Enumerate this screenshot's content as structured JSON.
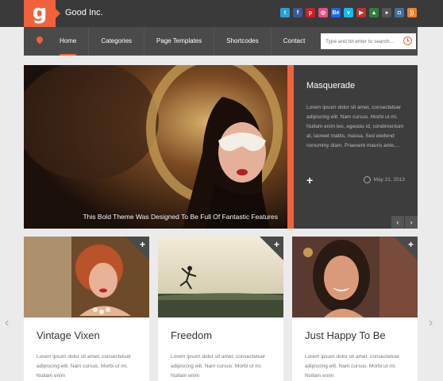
{
  "brand": {
    "logo_letter": "g",
    "name": "Good Inc."
  },
  "social": [
    {
      "icon": "twitter-icon",
      "glyph": "t",
      "color": "#2a9fd6"
    },
    {
      "icon": "facebook-icon",
      "glyph": "f",
      "color": "#3b5998"
    },
    {
      "icon": "pinterest-icon",
      "glyph": "p",
      "color": "#cb2027"
    },
    {
      "icon": "dribbble-icon",
      "glyph": "◎",
      "color": "#ea4c89"
    },
    {
      "icon": "behance-icon",
      "glyph": "Be",
      "color": "#1769ff"
    },
    {
      "icon": "vimeo-icon",
      "glyph": "v",
      "color": "#1ab7ea"
    },
    {
      "icon": "youtube-icon",
      "glyph": "▶",
      "color": "#c4302b"
    },
    {
      "icon": "forrst-icon",
      "glyph": "▲",
      "color": "#2f7f3d"
    },
    {
      "icon": "github-icon",
      "glyph": "●",
      "color": "#555555"
    },
    {
      "icon": "instagram-icon",
      "glyph": "◘",
      "color": "#3f729b"
    },
    {
      "icon": "rss-icon",
      "glyph": "))",
      "color": "#ee802f"
    }
  ],
  "nav": {
    "items": [
      "Home",
      "Categories",
      "Page Templates",
      "Shortcodes",
      "Contact"
    ],
    "active": "Home"
  },
  "search": {
    "placeholder": "Type and hit enter to search..."
  },
  "hero": {
    "caption": "This Bold Theme Was Designed To Be Full Of Fantastic Features",
    "title": "Masquerade",
    "text": "Lorem ipsum dolor sit amet, consectetuer adipiscing elit. Nam cursus. Morbi ut mi. Nullam enim leo, egestas id, condimentum at, laoreet mattis, massa. Sed eleifend nonummy diam. Praesent mauris ante,...",
    "date": "May 21, 2013"
  },
  "cards": [
    {
      "title": "Vintage Vixen",
      "text": "Lorem ipsum dolor sit amet, consectetuer adipiscing elit. Nam cursus. Morbi ut mi. Nullam enim"
    },
    {
      "title": "Freedom",
      "text": "Lorem ipsum dolor sit amet, consectetuer adipiscing elit. Nam cursus. Morbi ut mi. Nullam enim"
    },
    {
      "title": "Just Happy To Be",
      "text": "Lorem ipsum dolor sit amet, consectetuer adipiscing elit. Nam cursus. Morbi ut mi. Nullam enim"
    }
  ],
  "colors": {
    "accent": "#f0623b",
    "header": "#3a3a3a",
    "nav": "#4a4a4a"
  }
}
